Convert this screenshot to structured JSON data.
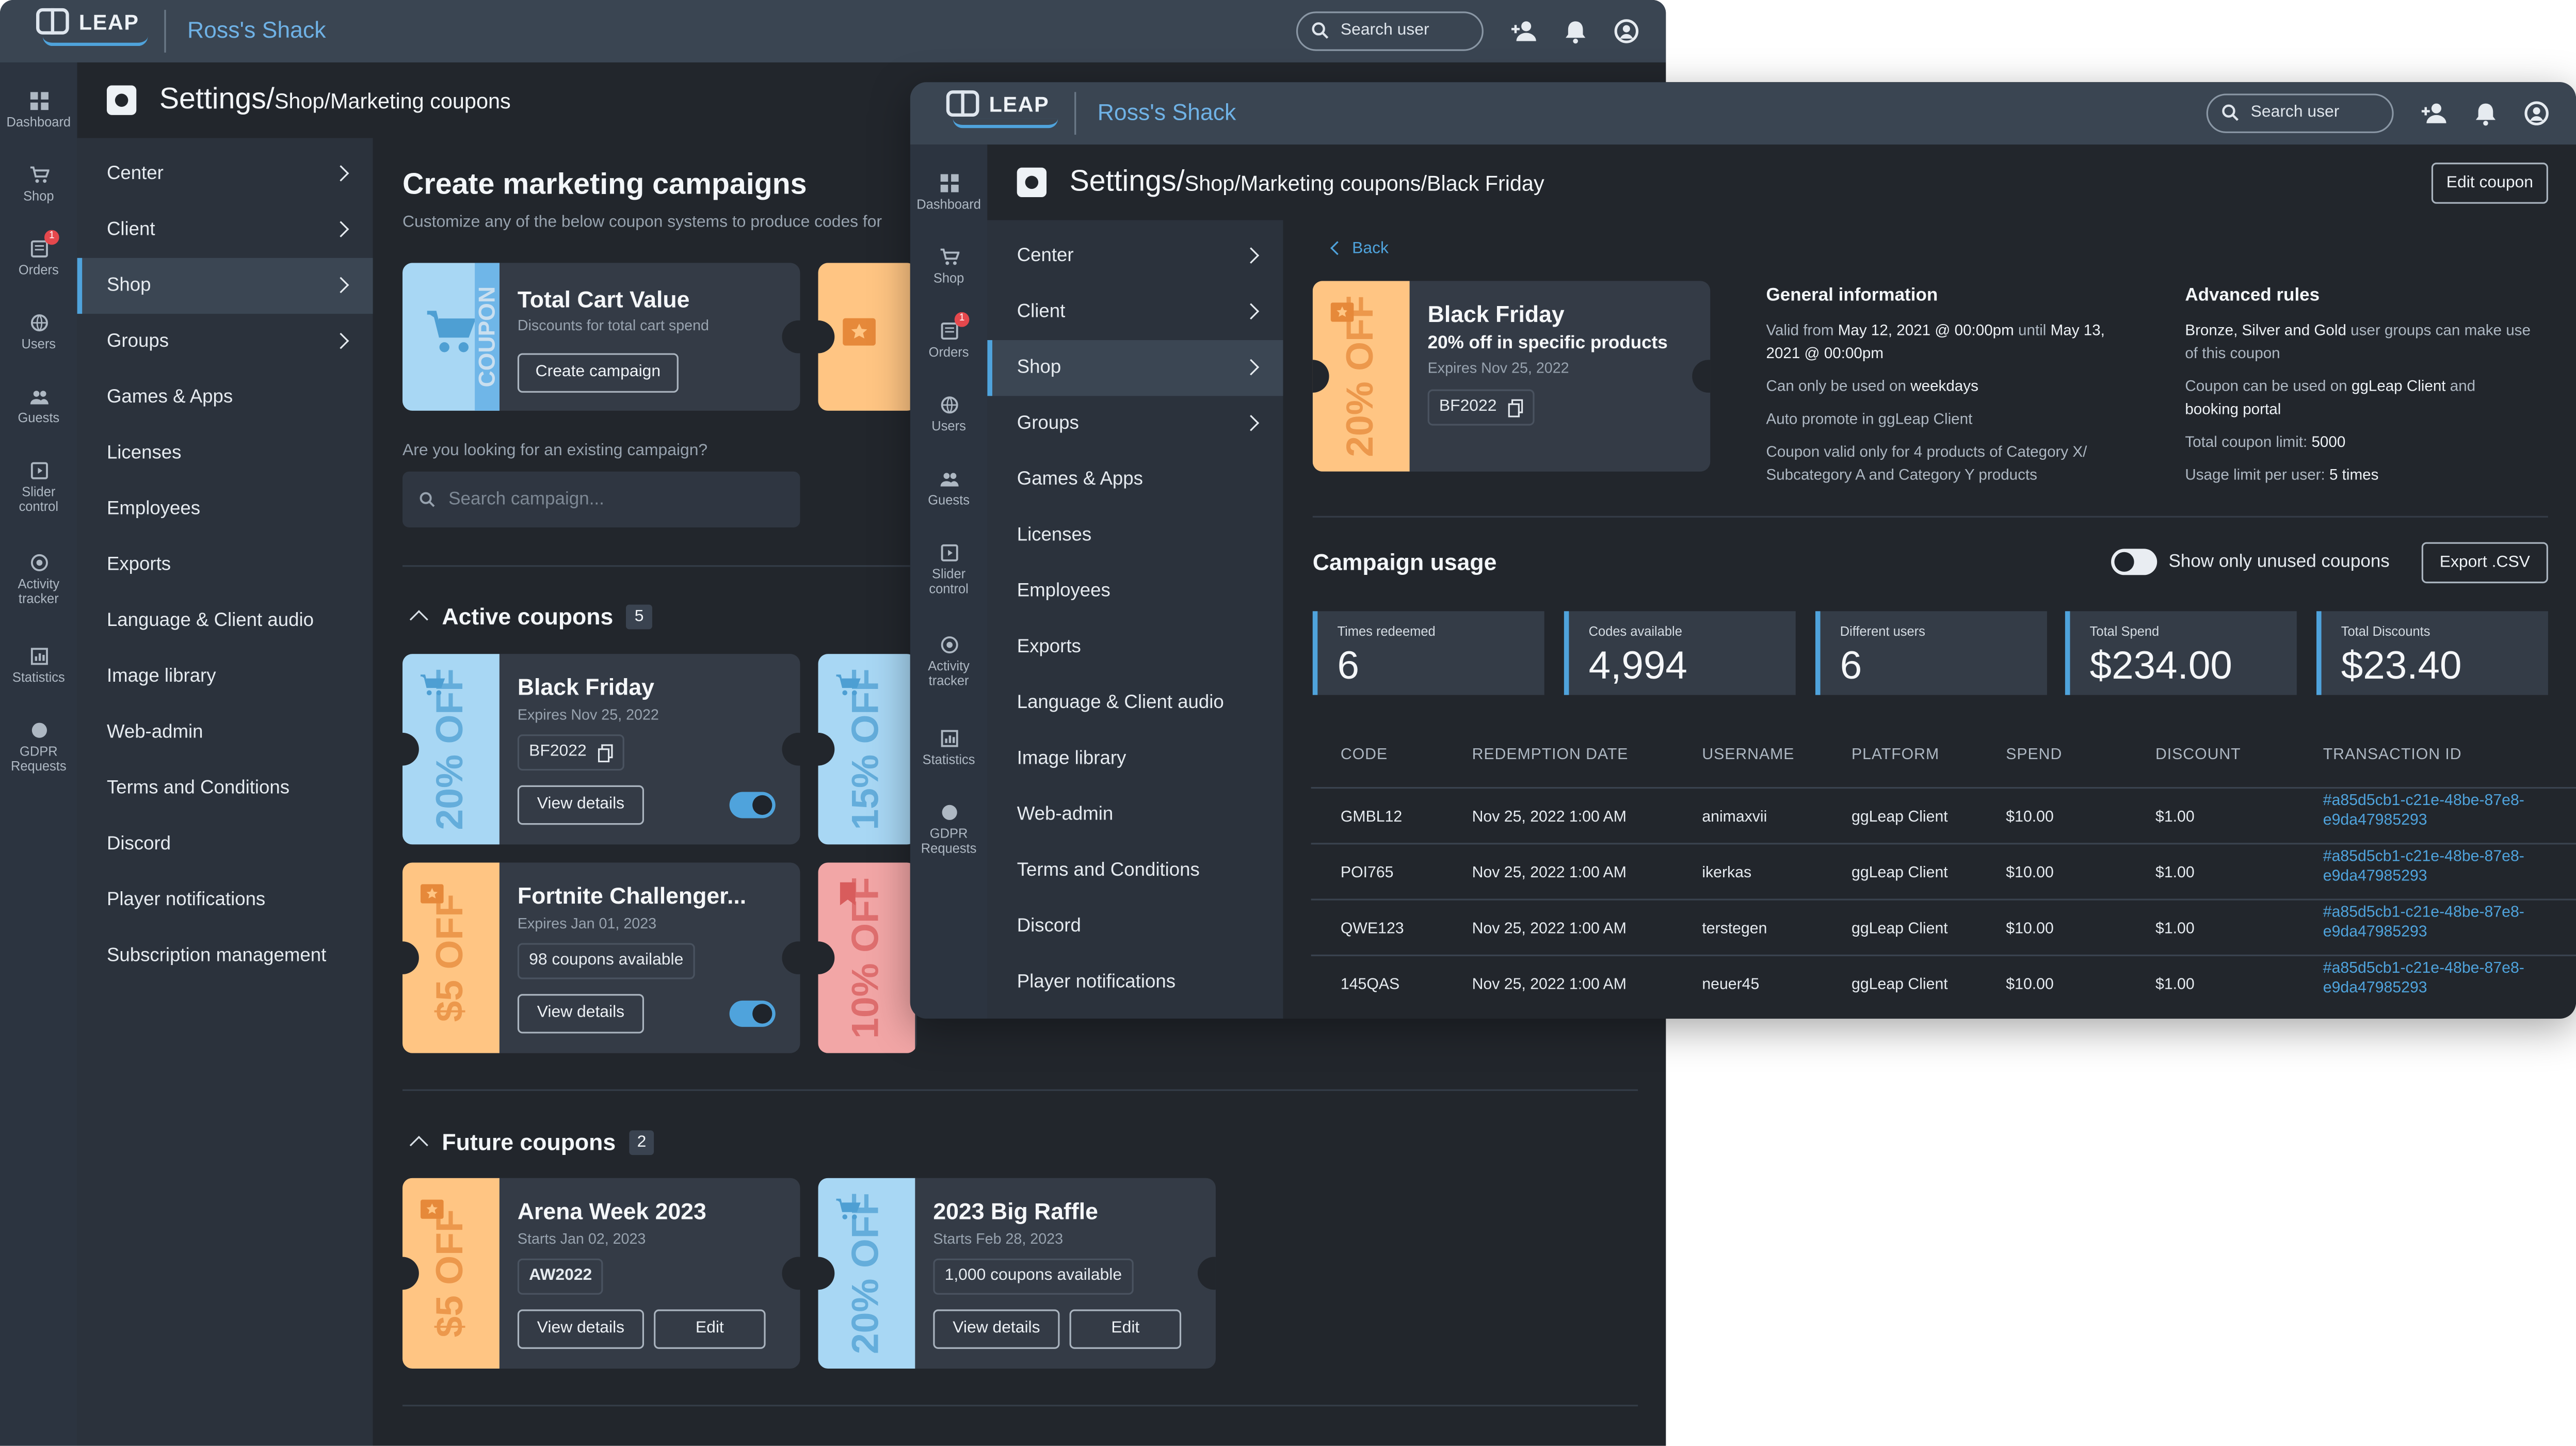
{
  "back": {
    "app": {
      "logo": "LEAP",
      "shop_name": "Ross's Shack",
      "search_placeholder": "Search user"
    },
    "rail": [
      {
        "label": "Dashboard"
      },
      {
        "label": "Shop"
      },
      {
        "label": "Orders",
        "badge": "1"
      },
      {
        "label": "Users"
      },
      {
        "label": "Guests"
      },
      {
        "label": "Slider control"
      },
      {
        "label": "Activity tracker"
      },
      {
        "label": "Statistics"
      },
      {
        "label": "GDPR Requests"
      }
    ],
    "header": {
      "title": "Settings/",
      "subtitle": "Shop/Marketing coupons"
    },
    "sidebar": [
      {
        "label": "Center"
      },
      {
        "label": "Client"
      },
      {
        "label": "Shop"
      },
      {
        "label": "Groups"
      },
      {
        "label": "Games & Apps"
      },
      {
        "label": "Licenses"
      },
      {
        "label": "Employees"
      },
      {
        "label": "Exports"
      },
      {
        "label": "Language & Client audio"
      },
      {
        "label": "Image library"
      },
      {
        "label": "Web-admin"
      },
      {
        "label": "Terms and Conditions"
      },
      {
        "label": "Discord"
      },
      {
        "label": "Player notifications"
      },
      {
        "label": "Subscription management"
      }
    ],
    "main": {
      "title": "Create marketing campaigns",
      "subtitle": "Customize any of the below coupon systems to produce codes for",
      "total_cart": {
        "title": "Total Cart Value",
        "desc": "Discounts for total cart spend",
        "button": "Create campaign",
        "stub": "COUPON"
      },
      "question": "Are you looking for an existing campaign?",
      "search_placeholder": "Search campaign...",
      "active": {
        "label": "Active coupons",
        "count": "5"
      },
      "future": {
        "label": "Future coupons",
        "count": "2"
      },
      "cards": {
        "black_friday": {
          "title": "Black Friday",
          "meta": "Expires Nov 25, 2022",
          "code": "BF2022",
          "button": "View details",
          "stub": "20% OFF"
        },
        "blue2": {
          "stub": "15% OFF"
        },
        "fortnite": {
          "title": "Fortnite Challenger...",
          "meta": "Expires Jan 01, 2023",
          "tag": "98 coupons available",
          "button": "View details",
          "stub": "$5 OFF"
        },
        "pink": {
          "stub": "10% OFF"
        },
        "arena": {
          "title": "Arena Week 2023",
          "meta": "Starts Jan 02, 2023",
          "code": "AW2022",
          "button": "View details",
          "edit": "Edit",
          "stub": "$5 OFF"
        },
        "raffle": {
          "title": "2023 Big Raffle",
          "meta": "Starts Feb 28, 2023",
          "tag": "1,000 coupons available",
          "button": "View details",
          "edit": "Edit",
          "stub": "20% OFF"
        }
      }
    }
  },
  "front": {
    "app": {
      "logo": "LEAP",
      "shop_name": "Ross's Shack",
      "search_placeholder": "Search user"
    },
    "rail": [
      {
        "label": "Dashboard"
      },
      {
        "label": "Shop"
      },
      {
        "label": "Orders",
        "badge": "1"
      },
      {
        "label": "Users"
      },
      {
        "label": "Guests"
      },
      {
        "label": "Slider control"
      },
      {
        "label": "Activity tracker"
      },
      {
        "label": "Statistics"
      },
      {
        "label": "GDPR Requests"
      }
    ],
    "header": {
      "title": "Settings/",
      "subtitle": "Shop/Marketing coupons/Black Friday",
      "edit_button": "Edit coupon"
    },
    "sidebar": [
      {
        "label": "Center"
      },
      {
        "label": "Client"
      },
      {
        "label": "Shop"
      },
      {
        "label": "Groups"
      },
      {
        "label": "Games & Apps"
      },
      {
        "label": "Licenses"
      },
      {
        "label": "Employees"
      },
      {
        "label": "Exports"
      },
      {
        "label": "Language & Client audio"
      },
      {
        "label": "Image library"
      },
      {
        "label": "Web-admin"
      },
      {
        "label": "Terms and Conditions"
      },
      {
        "label": "Discord"
      },
      {
        "label": "Player notifications"
      }
    ],
    "back_link": "Back",
    "coupon": {
      "title": "Black Friday",
      "subtitle": "20% off in specific products",
      "meta": "Expires Nov 25, 2022",
      "code": "BF2022",
      "stub": "20% OFF"
    },
    "general": {
      "title": "General information",
      "valid_prefix": "Valid from ",
      "valid_from": "May 12, 2021 @ 00:00pm",
      "valid_mid": " until ",
      "valid_to": "May 13,",
      "valid_to2": "2021 @ 00:00pm",
      "days_prefix": "Can only be used on ",
      "days": "weekdays",
      "promote": "Auto promote in ggLeap Client",
      "products_1": "Coupon valid only for 4 products of Category X/",
      "products_2": "Subcategory A and Category Y products"
    },
    "advanced": {
      "title": "Advanced rules",
      "groups_1a": "Bronze, Silver and Gold",
      "groups_1b": " user groups can make use",
      "groups_2": "of this coupon",
      "used_prefix": "Coupon can be used on ",
      "used_where": "ggLeap Client",
      "used_and": " and",
      "used_where2": "booking portal",
      "limit_prefix": "Total coupon limit: ",
      "limit": "5000",
      "per_user_prefix": "Usage limit per user: ",
      "per_user": "5 times"
    },
    "usage": {
      "title": "Campaign usage",
      "toggle_label": "Show only unused coupons",
      "export": "Export .CSV",
      "stats": [
        {
          "label": "Times redeemed",
          "value": "6"
        },
        {
          "label": "Codes available",
          "value": "4,994"
        },
        {
          "label": "Different users",
          "value": "6"
        },
        {
          "label": "Total Spend",
          "value": "$234.00"
        },
        {
          "label": "Total Discounts",
          "value": "$23.40"
        }
      ],
      "columns": [
        "CODE",
        "REDEMPTION DATE",
        "USERNAME",
        "PLATFORM",
        "SPEND",
        "DISCOUNT",
        "TRANSACTION ID"
      ],
      "rows": [
        {
          "code": "GMBL12",
          "date": "Nov 25, 2022 1:00 AM",
          "user": "animaxvii",
          "platform": "ggLeap Client",
          "spend": "$10.00",
          "discount": "$1.00",
          "tx1": "#a85d5cb1-c21e-48be-87e8-",
          "tx2": "e9da47985293"
        },
        {
          "code": "POI765",
          "date": "Nov 25, 2022 1:00 AM",
          "user": "ikerkas",
          "platform": "ggLeap Client",
          "spend": "$10.00",
          "discount": "$1.00",
          "tx1": "#a85d5cb1-c21e-48be-87e8-",
          "tx2": "e9da47985293"
        },
        {
          "code": "QWE123",
          "date": "Nov 25, 2022 1:00 AM",
          "user": "terstegen",
          "platform": "ggLeap Client",
          "spend": "$10.00",
          "discount": "$1.00",
          "tx1": "#a85d5cb1-c21e-48be-87e8-",
          "tx2": "e9da47985293"
        },
        {
          "code": "145QAS",
          "date": "Nov 25, 2022 1:00 AM",
          "user": "neuer45",
          "platform": "ggLeap Client",
          "spend": "$10.00",
          "discount": "$1.00",
          "tx1": "#a85d5cb1-c21e-48be-87e8-",
          "tx2": "e9da47985293"
        }
      ]
    }
  },
  "colors": {
    "accent": "#4fa3dc",
    "bg": "#22262c",
    "sidebar": "#2b323c",
    "topbar": "#3a4552",
    "orange": "#ffc583",
    "blue": "#a8d7f4",
    "pink": "#f2a6a6"
  },
  "icons": [
    "search-icon",
    "add-user-icon",
    "bell-icon",
    "account-icon",
    "dashboard-icon",
    "cart-icon",
    "orders-icon",
    "globe-icon",
    "guests-icon",
    "slider-icon",
    "activity-icon",
    "statistics-icon",
    "gdpr-icon",
    "gear-icon",
    "chevron-right-icon",
    "chevron-up-icon",
    "copy-icon",
    "star-ticket-icon",
    "bookmark-icon",
    "chevron-left-icon"
  ]
}
